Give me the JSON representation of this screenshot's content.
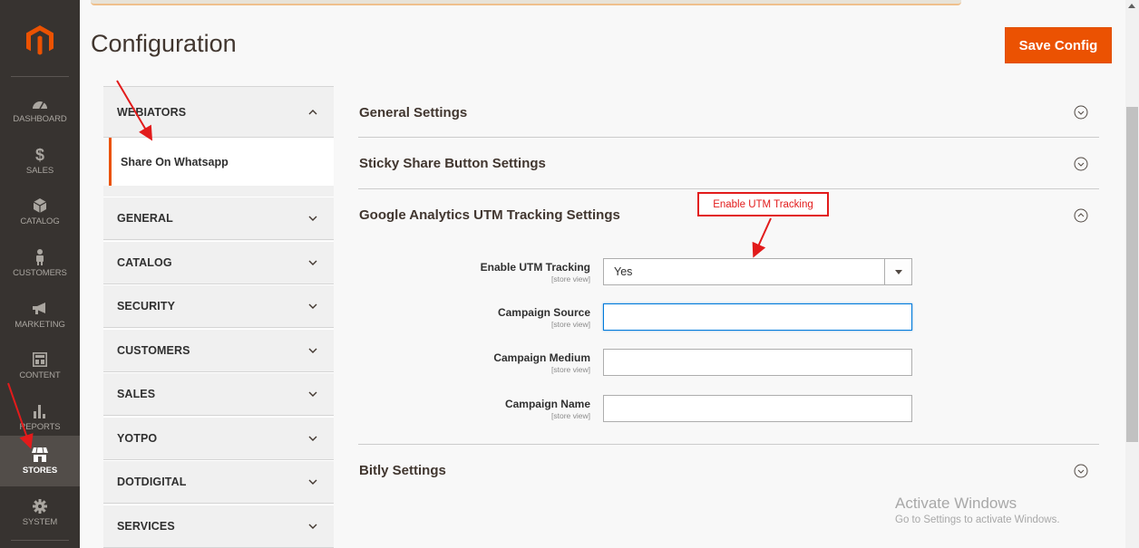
{
  "header": {
    "title": "Configuration",
    "save_label": "Save Config"
  },
  "nav": {
    "items": [
      {
        "label": "DASHBOARD",
        "icon": "dashboard-icon"
      },
      {
        "label": "SALES",
        "icon": "dollar-icon"
      },
      {
        "label": "CATALOG",
        "icon": "cube-icon"
      },
      {
        "label": "CUSTOMERS",
        "icon": "person-icon"
      },
      {
        "label": "MARKETING",
        "icon": "megaphone-icon"
      },
      {
        "label": "CONTENT",
        "icon": "layout-icon"
      },
      {
        "label": "REPORTS",
        "icon": "bar-chart-icon"
      },
      {
        "label": "STORES",
        "icon": "store-icon",
        "active": true
      },
      {
        "label": "SYSTEM",
        "icon": "gear-icon"
      }
    ]
  },
  "tabs": {
    "webiators": "WEBIATORS",
    "share_on_whatsapp": "Share On Whatsapp",
    "general": "GENERAL",
    "catalog": "CATALOG",
    "security": "SECURITY",
    "customers": "CUSTOMERS",
    "sales": "SALES",
    "yotpo": "YOTPO",
    "dotdigital": "DOTDIGITAL",
    "services": "SERVICES"
  },
  "sections": {
    "general": "General Settings",
    "sticky": "Sticky Share Button Settings",
    "utm": "Google Analytics UTM Tracking Settings",
    "bitly": "Bitly Settings"
  },
  "fields": {
    "enable_utm": {
      "label": "Enable UTM Tracking",
      "scope": "[store view]",
      "value": "Yes"
    },
    "campaign_source": {
      "label": "Campaign Source",
      "scope": "[store view]",
      "value": ""
    },
    "campaign_medium": {
      "label": "Campaign Medium",
      "scope": "[store view]",
      "value": ""
    },
    "campaign_name": {
      "label": "Campaign Name",
      "scope": "[store view]",
      "value": ""
    }
  },
  "annotation": {
    "text": "Enable UTM Tracking",
    "color": "#e21b1b"
  },
  "watermark": {
    "line1": "Activate Windows",
    "line2": "Go to Settings to activate Windows."
  },
  "colors": {
    "accent": "#eb5202",
    "nav_bg": "#373330"
  }
}
